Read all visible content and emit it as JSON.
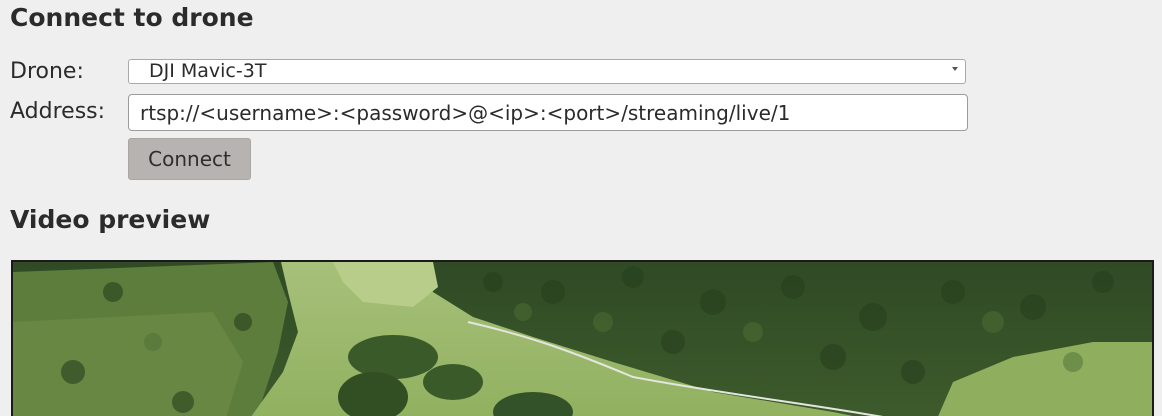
{
  "connect_section": {
    "title": "Connect to drone",
    "drone_label": "Drone:",
    "drone_selected": "DJI Mavic-3T",
    "address_label": "Address:",
    "address_value": "rtsp://<username>:<password>@<ip>:<port>/streaming/live/1",
    "connect_button_label": "Connect"
  },
  "video_section": {
    "title": "Video preview"
  },
  "icons": {
    "dropdown": "chevron-down-icon"
  },
  "colors": {
    "background": "#f0eff0",
    "button": "#b6b3b1",
    "text": "#2b2b2b"
  }
}
